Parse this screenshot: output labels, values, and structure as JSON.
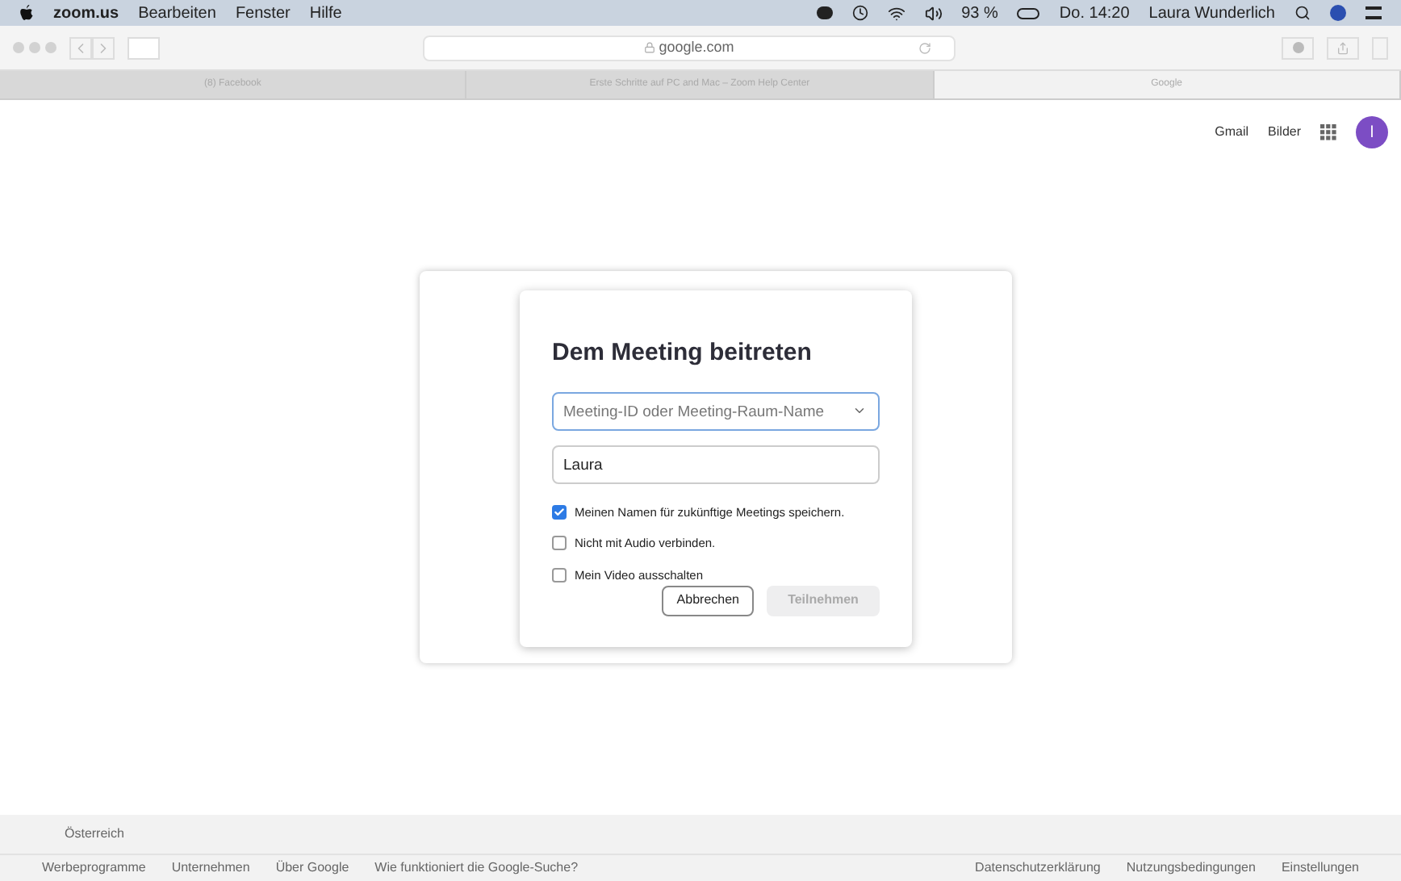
{
  "menu_bar": {
    "app": "zoom.us",
    "items": [
      "Bearbeiten",
      "Fenster",
      "Hilfe"
    ],
    "battery": "93 %",
    "clock": "Do. 14:20",
    "user": "Laura Wunderlich"
  },
  "browser": {
    "address": "google.com",
    "tabs": [
      {
        "label": "(8) Facebook",
        "selected": false
      },
      {
        "label": "Erste Schritte auf PC and Mac – Zoom Help Center",
        "selected": false
      },
      {
        "label": "Google",
        "selected": true
      }
    ]
  },
  "google_header": {
    "links": [
      "Gmail",
      "Bilder"
    ],
    "avatar": "l"
  },
  "dialog": {
    "title": "Dem Meeting beitreten",
    "meeting_field": {
      "placeholder": "Meeting-ID oder Meeting-Raum-Name"
    },
    "name_field": {
      "value": "Laura"
    },
    "options": [
      {
        "label": "Meinen Namen für zukünftige Meetings speichern.",
        "checked": true
      },
      {
        "label": "Nicht mit Audio verbinden.",
        "checked": false
      },
      {
        "label": "Mein Video ausschalten",
        "checked": false
      }
    ],
    "buttons": [
      {
        "label": "Abbrechen",
        "disabled": false
      },
      {
        "label": "Teilnehmen",
        "disabled": true
      }
    ]
  },
  "footer": {
    "country": "Österreich",
    "left_links": [
      "Werbeprogramme",
      "Unternehmen",
      "Über Google",
      "Wie funktioniert die Google-Suche?"
    ],
    "right_links": [
      "Datenschutzerklärung",
      "Nutzungsbedingungen",
      "Einstellungen"
    ]
  }
}
